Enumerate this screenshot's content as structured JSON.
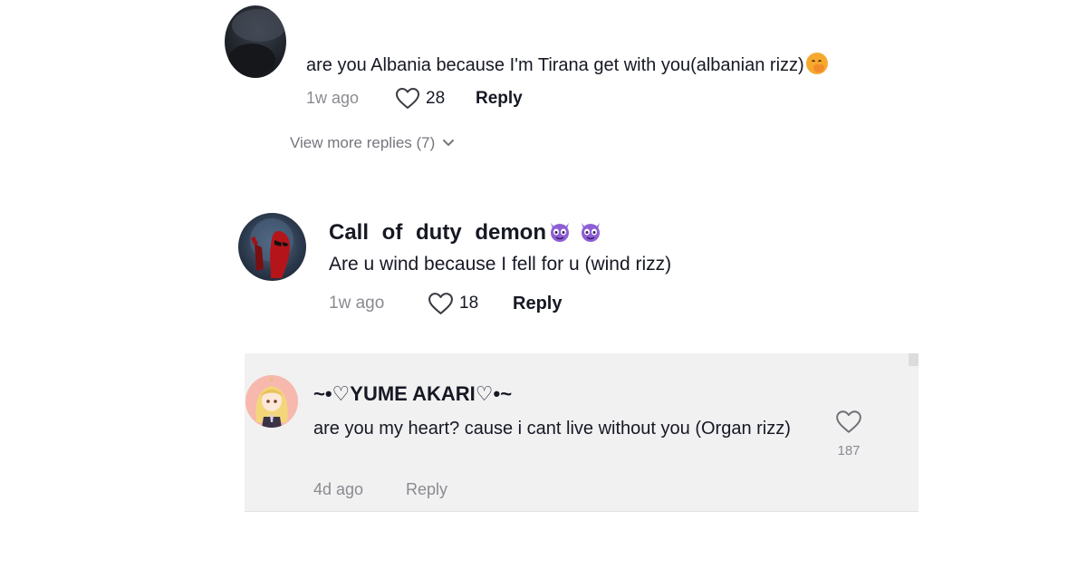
{
  "comments": [
    {
      "username_partial": "",
      "text": "are you Albania because I'm Tirana get with you(albanian rizz)",
      "text_emoji": "face-with-hand-over-mouth",
      "time": "1w ago",
      "likes": "28",
      "reply_label": "Reply",
      "view_more": "View more replies (7)"
    },
    {
      "username": "Call of duty demon",
      "username_emojis": [
        "smiling-imp",
        "smiling-imp"
      ],
      "text": "Are u wind because I fell for u (wind rizz)",
      "time": "1w ago",
      "likes": "18",
      "reply_label": "Reply"
    }
  ],
  "reply": {
    "username": "~•♡YUME AKARI♡•~",
    "text": "are you my heart? cause i cant live without you (Organ rizz)",
    "time": "4d ago",
    "reply_label": "Reply",
    "likes": "187"
  },
  "colors": {
    "text_primary": "#161823",
    "text_secondary": "#8a8b91",
    "panel_bg": "#f1f1f2",
    "emoji_purple": "#8e5fd4",
    "emoji_orange": "#f6a92f"
  }
}
